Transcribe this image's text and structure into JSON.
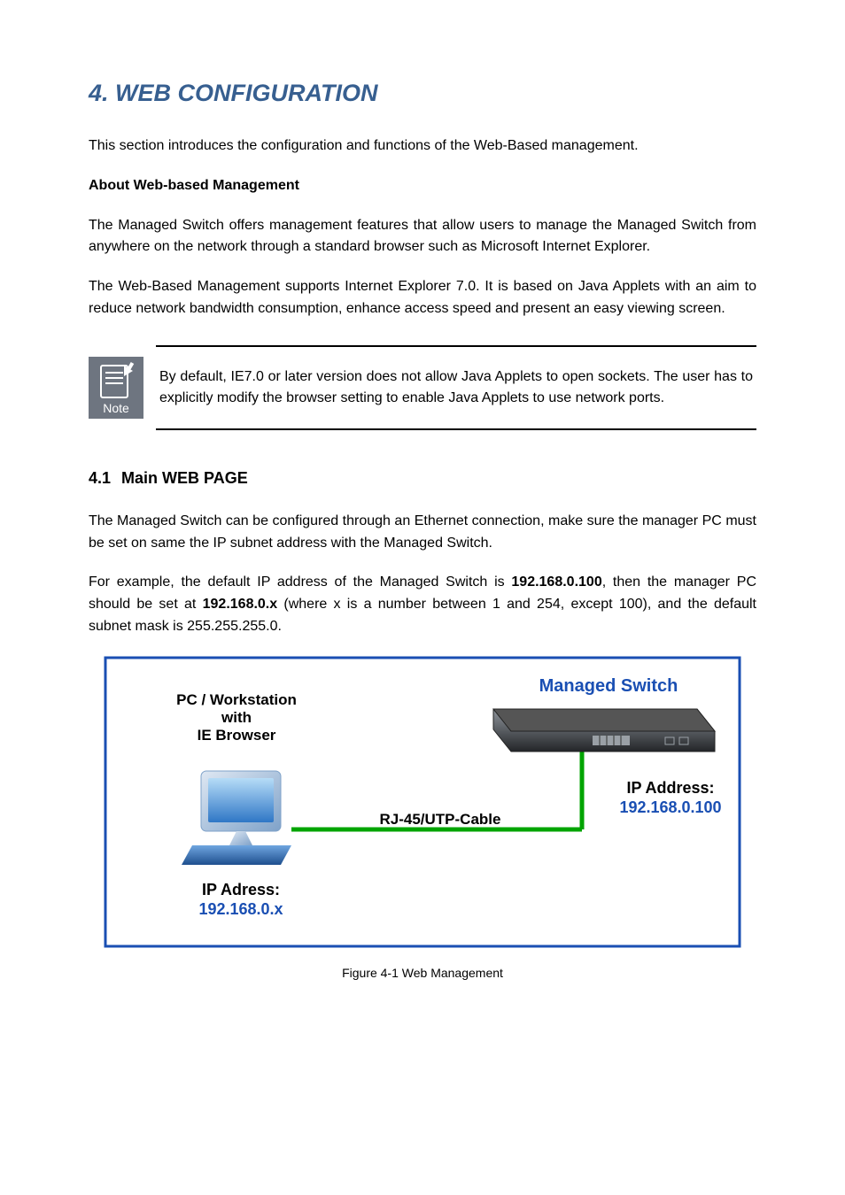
{
  "chapter": {
    "title": "4. WEB CONFIGURATION"
  },
  "intro_para_1": "This section introduces the configuration and functions of the Web-Based management.",
  "about_heading": "About Web-based Management",
  "intro_para_2": "The Managed Switch offers management features that allow users to manage the Managed Switch from anywhere on the network through a standard browser such as Microsoft Internet Explorer.",
  "intro_para_3_a": "The Web-Based Management supports Internet Explorer 7.0. It is based on Java Applets with an aim to reduce network bandwidth consumption, enhance access speed and present an easy viewing screen.",
  "note_text": "By default, IE7.0 or later version does not allow Java Applets to open sockets. The user has to explicitly modify the browser setting to enable Java Applets to use network ports.",
  "intro_para_4": "The Managed Switch can be configured through an Ethernet connection, make sure the manager PC must be set on same the IP subnet address with the Managed Switch.",
  "intro_para_5_prefix": "For example, the default IP address of the Managed Switch is ",
  "default_ip": "192.168.0.100",
  "intro_para_5_mid": ", then the manager PC should be set at ",
  "pc_ip_pattern": "192.168.0.x",
  "intro_para_5_mid2": " (where x is a number between 1 and 254, except 100), and the default subnet mask is 255.255.255.0.",
  "section": {
    "num": "4.1",
    "title": "Main WEB PAGE"
  },
  "diagram": {
    "title": "Web Management",
    "pc_label_1": "PC / Workstation",
    "pc_label_2": "with",
    "pc_label_3": "IE Browser",
    "pc_ip_title": "IP Adress:",
    "pc_ip": "192.168.0.x",
    "cable_label": "RJ-45/UTP-Cable",
    "sw_label": "Managed Switch",
    "sw_ip_title": "IP Address:",
    "sw_ip": "192.168.0.100"
  },
  "figure_caption": "Figure 4-1 Web Management"
}
